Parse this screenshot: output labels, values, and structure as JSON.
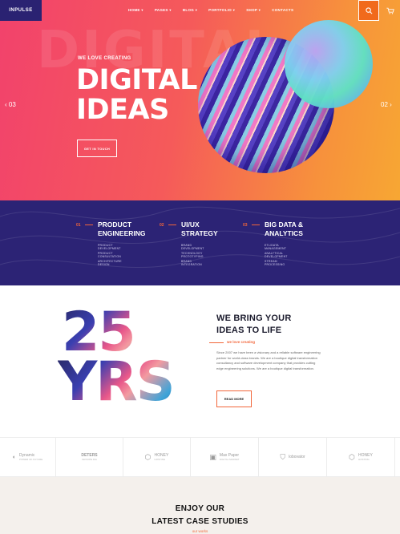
{
  "brand": {
    "logo_text": "INPULSE"
  },
  "nav": {
    "items": [
      {
        "label": "HOME"
      },
      {
        "label": "PAGES"
      },
      {
        "label": "BLOG"
      },
      {
        "label": "PORTFOLIO"
      },
      {
        "label": "SHOP"
      },
      {
        "label": "CONTACTS"
      }
    ],
    "search_icon": "search-icon",
    "cart_icon": "cart-icon"
  },
  "hero": {
    "background_word": "DIGITAL",
    "kicker": "WE LOVE CREATING",
    "headline_line1": "DIGITAL",
    "headline_line2": "IDEAS",
    "cta_label": "GET IN TOUCH",
    "prev_label": "03",
    "next_label": "02",
    "accent_color": "#f2663a"
  },
  "services": [
    {
      "number": "01",
      "title_line1": "PRODUCT",
      "title_line2": "ENGINEERING",
      "items": [
        "PRODUCT DEVELOPMENT",
        "PRODUCT CONSULTATION",
        "ARCHITECTURE DESIGN"
      ]
    },
    {
      "number": "02",
      "title_line1": "UI/UX",
      "title_line2": "STRATEGY",
      "items": [
        "BRAND DEVELOPMENT",
        "TECHNOLOGY PROTOTYPING",
        "BRAND INTEGRATION"
      ]
    },
    {
      "number": "03",
      "title_line1": "BIG DATA &",
      "title_line2": "ANALYTICS",
      "items": [
        "ETL/DATA MANAGEMENT",
        "ANALYTICAL DEVELOPMENT",
        "STREAM PROCESSING"
      ]
    }
  ],
  "about": {
    "years_number": "25",
    "years_text": "YRS",
    "title_line1": "WE BRING YOUR",
    "title_line2": "IDEAS TO LIFE",
    "kicker": "we love creating",
    "body": "Since 2007 we have been a visionary and a reliable software engineering partner for world-class brands. We are a boutique digital transformation consultancy and software development company that provides cutting edge engineering solutions. We are a boutique digital transformation.",
    "read_more_label": "READ MORE"
  },
  "clients": [
    {
      "name": "Dynamic",
      "sub": "POWER OF FUTURE"
    },
    {
      "name": "DETERS",
      "sub": "GROUPE DIA"
    },
    {
      "name": "HONEY",
      "sub": "HOSTING"
    },
    {
      "name": "Max Paper",
      "sub": "DIGITAL MARKET"
    },
    {
      "name": "lobovator",
      "sub": ""
    },
    {
      "name": "HONEY",
      "sub": "HOSTING"
    }
  ],
  "cases": {
    "title_line1": "ENJOY OUR",
    "title_line2": "LATEST CASE STUDIES",
    "kicker": "our works"
  }
}
